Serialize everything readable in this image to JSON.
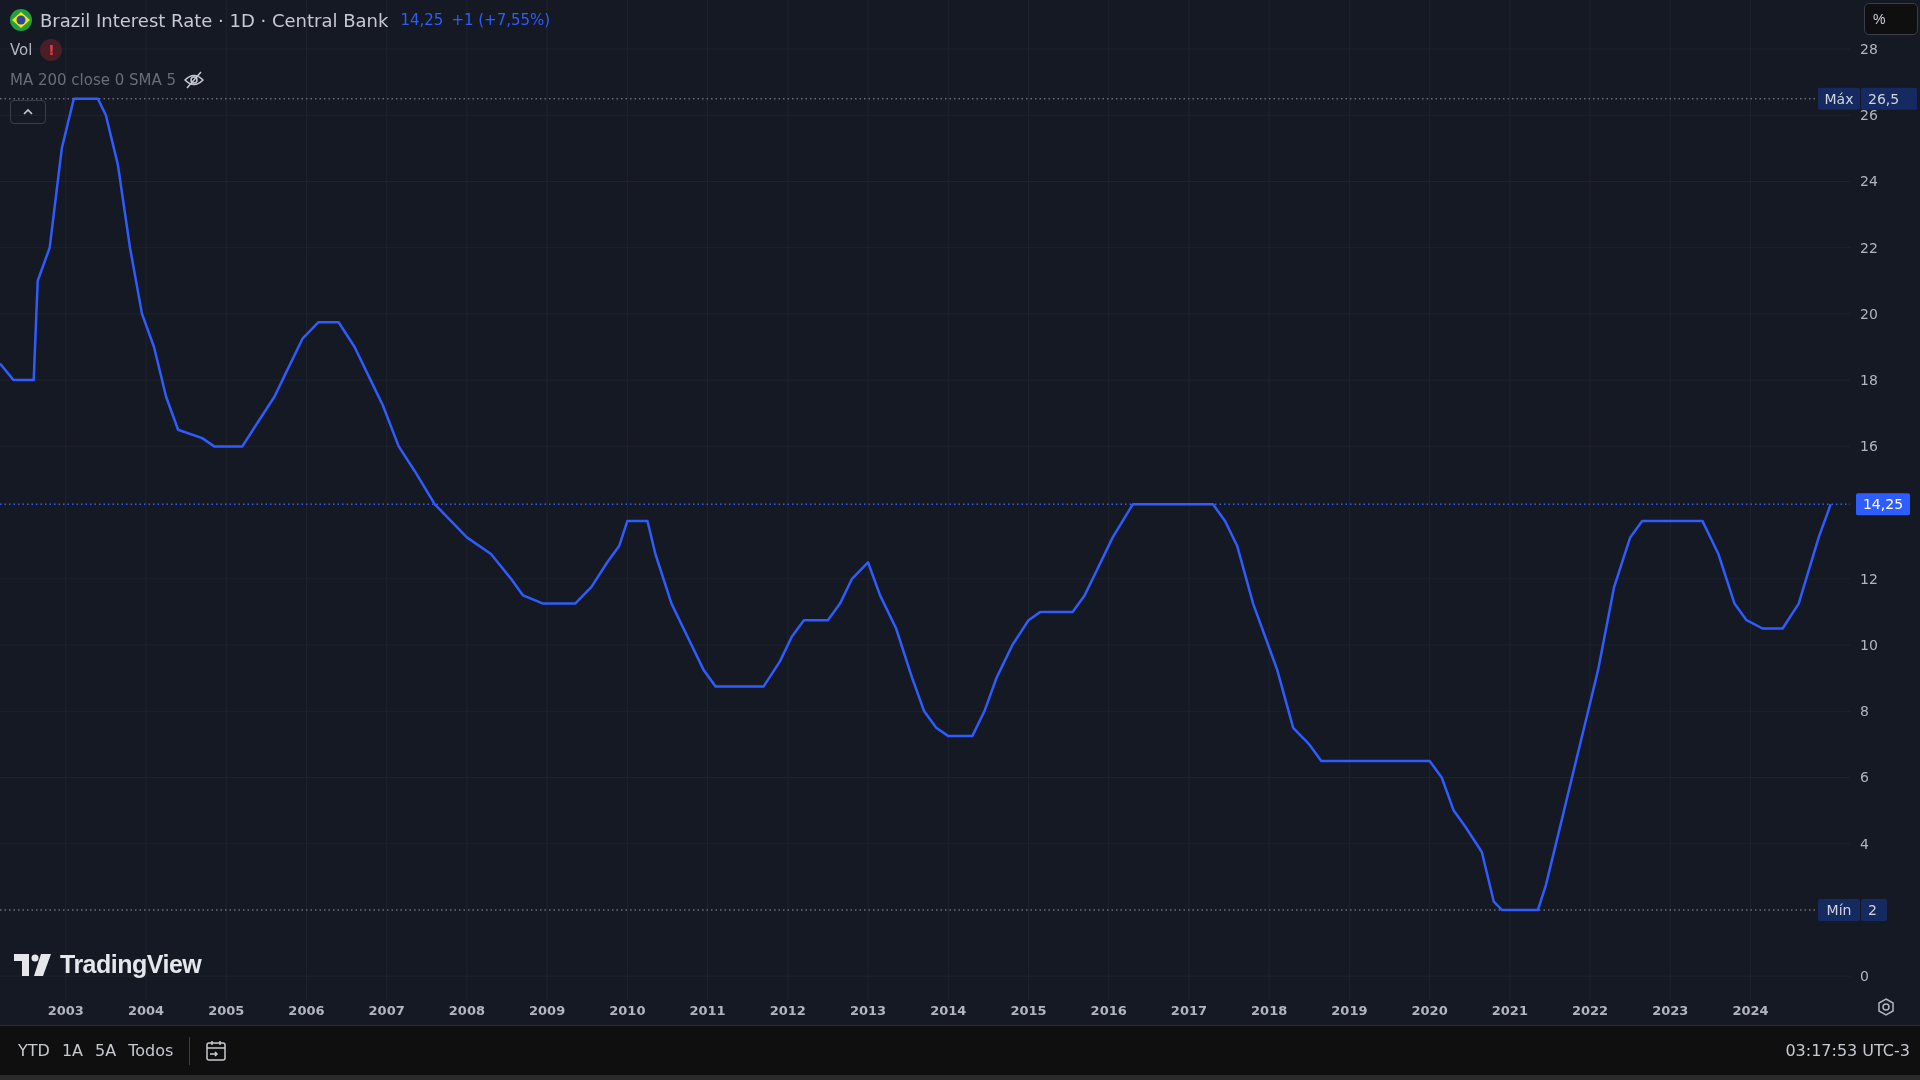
{
  "legend": {
    "title_suffix": " · 1D · Central Bank",
    "price": "14,25",
    "change": "+1 (+7,55%)",
    "indicators": [
      {
        "label": "Vol",
        "kind": "warning",
        "badge": "!"
      },
      {
        "label": "MA 200 close 0 SMA 5",
        "kind": "hidden"
      }
    ]
  },
  "scale_mode": "%",
  "brand": "TradingView",
  "chart_data": {
    "type": "line",
    "x": [
      2002.18,
      2002.35,
      2002.6,
      2002.65,
      2002.8,
      2002.95,
      2003.1,
      2003.4,
      2003.5,
      2003.65,
      2003.8,
      2003.95,
      2004.1,
      2004.25,
      2004.4,
      2004.7,
      2004.85,
      2005.2,
      2005.4,
      2005.6,
      2005.75,
      2005.95,
      2006.15,
      2006.4,
      2006.6,
      2006.8,
      2006.95,
      2007.15,
      2007.35,
      2007.6,
      2007.8,
      2008.0,
      2008.3,
      2008.55,
      2008.7,
      2008.95,
      2009.35,
      2009.55,
      2009.75,
      2009.9,
      2010.0,
      2010.25,
      2010.35,
      2010.55,
      2010.75,
      2010.95,
      2011.1,
      2011.7,
      2011.9,
      2012.05,
      2012.2,
      2012.5,
      2012.65,
      2012.8,
      2013.0,
      2013.15,
      2013.35,
      2013.55,
      2013.7,
      2013.85,
      2014.0,
      2014.3,
      2014.45,
      2014.6,
      2014.8,
      2015.0,
      2015.15,
      2015.55,
      2015.7,
      2015.85,
      2016.05,
      2016.3,
      2017.3,
      2017.45,
      2017.6,
      2017.8,
      2017.95,
      2018.1,
      2018.3,
      2018.5,
      2018.65,
      2020.0,
      2020.15,
      2020.3,
      2020.45,
      2020.65,
      2020.8,
      2020.9,
      2021.35,
      2021.45,
      2021.6,
      2021.8,
      2021.95,
      2022.1,
      2022.3,
      2022.5,
      2022.65,
      2023.4,
      2023.6,
      2023.8,
      2023.95,
      2024.15,
      2024.4,
      2024.6,
      2024.85,
      2025.0
    ],
    "series": [
      {
        "name": "Brazil Interest Rate",
        "color": "#2f5cff",
        "values": [
          18.5,
          18,
          18,
          21,
          22,
          25,
          26.5,
          26.5,
          26,
          24.5,
          22,
          20,
          19,
          17.5,
          16.5,
          16.25,
          16,
          16,
          16.75,
          17.5,
          18.25,
          19.25,
          19.75,
          19.75,
          19,
          18,
          17.25,
          16,
          15.25,
          14.25,
          13.75,
          13.25,
          12.75,
          12,
          11.5,
          11.25,
          11.25,
          11.75,
          12.5,
          13,
          13.75,
          13.75,
          12.75,
          11.25,
          10.25,
          9.25,
          8.75,
          8.75,
          9.5,
          10.25,
          10.75,
          10.75,
          11.25,
          12,
          12.5,
          11.5,
          10.5,
          9,
          8,
          7.5,
          7.25,
          7.25,
          8,
          9,
          10,
          10.75,
          11,
          11,
          11.5,
          12.25,
          13.25,
          14.25,
          14.25,
          13.75,
          13,
          11.25,
          10.25,
          9.25,
          7.5,
          7,
          6.5,
          6.5,
          6,
          5,
          4.5,
          3.75,
          2.25,
          2,
          2,
          2.75,
          4.25,
          6.25,
          7.75,
          9.25,
          11.75,
          13.25,
          13.75,
          13.75,
          12.75,
          11.25,
          10.75,
          10.5,
          10.5,
          11.25,
          13.25,
          14.25
        ]
      }
    ],
    "xlim": [
      2002.18,
      2025.24
    ],
    "ylim": [
      -0.72,
      29.48
    ],
    "xticks": [
      2003,
      2004,
      2005,
      2006,
      2007,
      2008,
      2009,
      2010,
      2011,
      2012,
      2013,
      2014,
      2015,
      2016,
      2017,
      2018,
      2019,
      2020,
      2021,
      2022,
      2023,
      2024
    ],
    "yticks": [
      0,
      4,
      6,
      8,
      10,
      12,
      16,
      18,
      20,
      22,
      24,
      26,
      28
    ],
    "grid": true,
    "ref_lines": [
      {
        "axis": "y",
        "value": 26.5,
        "label": "Máx",
        "color": "#6a6d78"
      },
      {
        "axis": "y",
        "value": 2,
        "label": "Mín",
        "color": "#6a6d78"
      },
      {
        "axis": "y",
        "value": 14.25,
        "color": "#2f5cff"
      }
    ],
    "annotations": [
      "26,5",
      "2",
      "14,25"
    ]
  },
  "range_buttons": [
    {
      "label": "YTD",
      "selected": false
    },
    {
      "label": "1A",
      "selected": false
    },
    {
      "label": "5A",
      "selected": false
    },
    {
      "label": "Todos",
      "selected": false
    }
  ],
  "clock": "03:17:53 UTC-3"
}
